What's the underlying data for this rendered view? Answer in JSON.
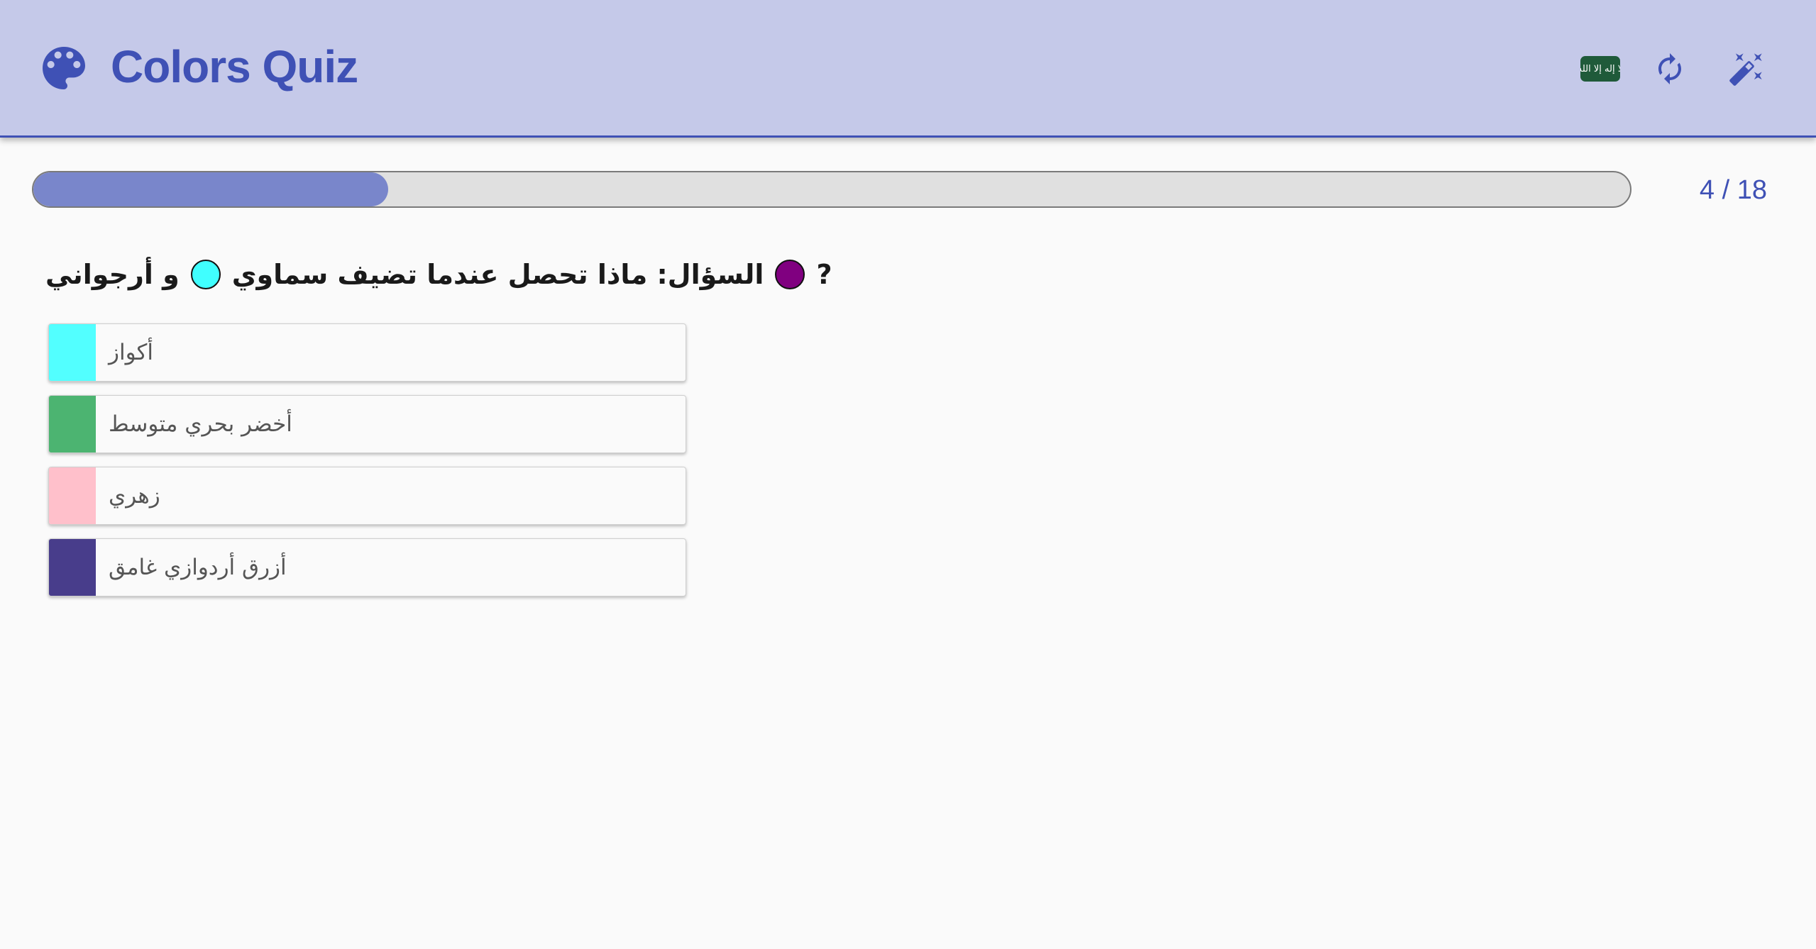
{
  "header": {
    "title": "Colors Quiz",
    "icons": {
      "brand": "palette-icon",
      "language": "saudi-flag-icon",
      "reset": "refresh-icon",
      "magic": "magic-wand-icon"
    },
    "flag_text": "لا إله إلا الله"
  },
  "progress": {
    "current": 4,
    "total": 18,
    "label": "4 / 18",
    "fraction": 0.222
  },
  "question": {
    "prefix": "? ",
    "text_before": "السؤال: ماذا تحصل عندما تضيف سماوي",
    "connector": "و أرجواني",
    "color_a": "#800080",
    "color_b": "#40ffff"
  },
  "options": [
    {
      "label": "أكواز",
      "color": "#52ffff"
    },
    {
      "label": "أخضر بحري متوسط",
      "color": "#4cb471"
    },
    {
      "label": "زهري",
      "color": "#ffc0cb"
    },
    {
      "label": "أزرق أردوازي غامق",
      "color": "#483d8b"
    }
  ],
  "colors": {
    "primary": "#3f51b5",
    "header_bg": "#c5c9e9",
    "progress_fill": "#7986cb",
    "background": "#fafafa"
  }
}
